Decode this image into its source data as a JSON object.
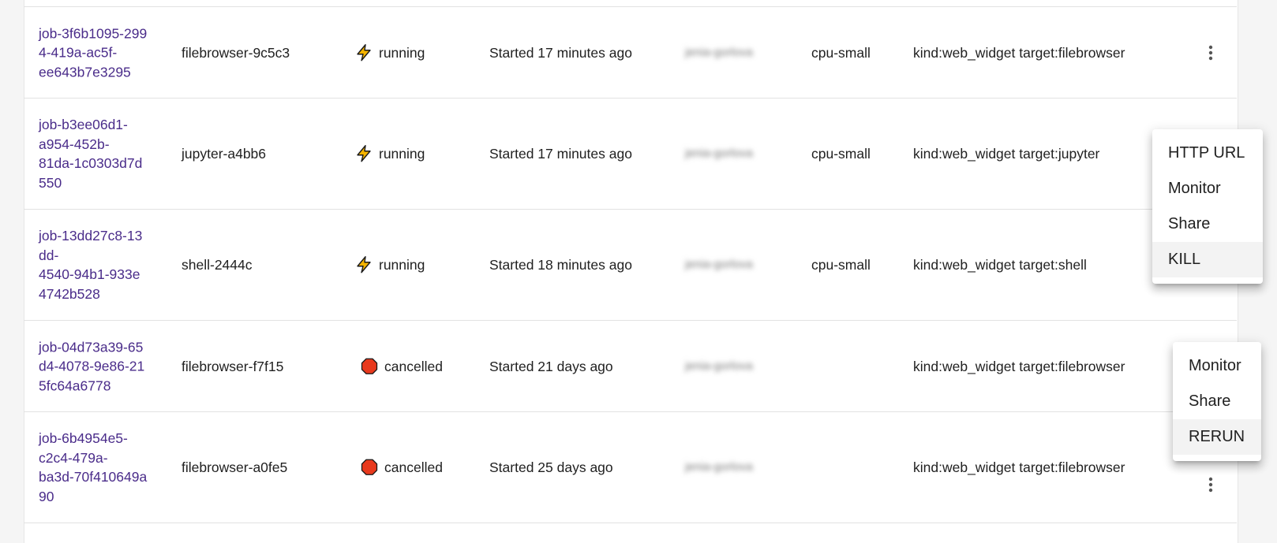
{
  "jobs": [
    {
      "id_lines": [
        "job-3f6b1095-299",
        "4-419a-ac5f-",
        "ee643b7e3295"
      ],
      "name": "filebrowser-9c5c3",
      "status": "running",
      "started": "Started 17 minutes ago",
      "owner": "jenia-gorlova",
      "preset": "cpu-small",
      "tags": "kind:web_widget target:filebrowser"
    },
    {
      "id_lines": [
        "job-b3ee06d1-",
        "a954-452b-",
        "81da-1c0303d7d",
        "550"
      ],
      "name": "jupyter-a4bb6",
      "status": "running",
      "started": "Started 17 minutes ago",
      "owner": "jenia-gorlova",
      "preset": "cpu-small",
      "tags": "kind:web_widget target:jupyter"
    },
    {
      "id_lines": [
        "job-13dd27c8-13",
        "dd-",
        "4540-94b1-933e",
        "4742b528"
      ],
      "name": "shell-2444c",
      "status": "running",
      "started": "Started 18 minutes ago",
      "owner": "jenia-gorlova",
      "preset": "cpu-small",
      "tags": "kind:web_widget target:shell"
    },
    {
      "id_lines": [
        "job-04d73a39-65",
        "d4-4078-9e86-21",
        "5fc64a6778"
      ],
      "name": "filebrowser-f7f15",
      "status": "cancelled",
      "started": "Started 21 days ago",
      "owner": "jenia-gorlova",
      "preset": "",
      "tags": "kind:web_widget target:filebrowser"
    },
    {
      "id_lines": [
        "job-6b4954e5-",
        "c2c4-479a-",
        "ba3d-70f410649a",
        "90"
      ],
      "name": "filebrowser-a0fe5",
      "status": "cancelled",
      "started": "Started 25 days ago",
      "owner": "jenia-gorlova",
      "preset": "",
      "tags": "kind:web_widget target:filebrowser"
    }
  ],
  "menu_running": {
    "items": [
      "HTTP URL",
      "Monitor",
      "Share",
      "KILL"
    ]
  },
  "menu_cancelled": {
    "items": [
      "Monitor",
      "Share",
      "RERUN"
    ]
  },
  "icons": {
    "running": "lightning-bolt-icon",
    "cancelled": "stop-octagon-icon",
    "actions": "more-vert-icon"
  },
  "colors": {
    "job_link": "#4a2c8a",
    "running_icon_fill": "#f5b400",
    "cancelled_icon_fill": "#e8391d",
    "menu_highlight": "#f3f3f3"
  }
}
